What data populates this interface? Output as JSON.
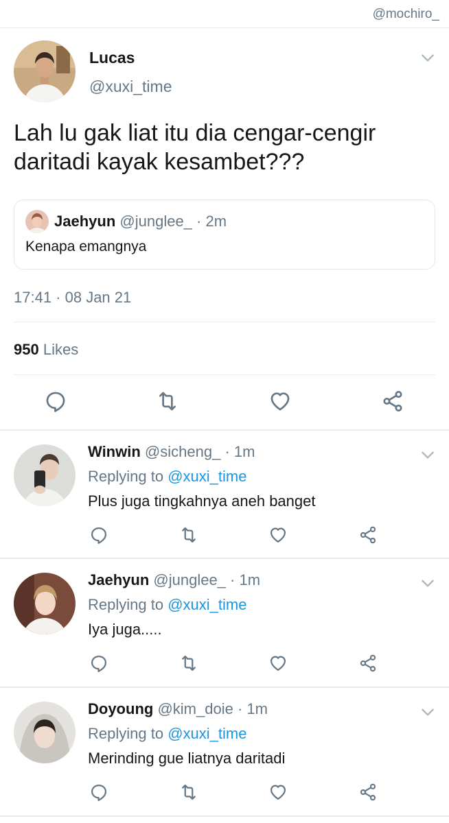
{
  "watermark": "@mochiro_",
  "main_tweet": {
    "name": "Lucas",
    "handle": "@xuxi_time",
    "text": "Lah lu gak liat itu dia cengar-cengir daritadi kayak kesambet???",
    "quote": {
      "name": "Jaehyun",
      "handle": "@junglee_",
      "separator": "·",
      "time": "2m",
      "text": "Kenapa emangnya"
    },
    "timestamp": "17:41 · 08 Jan 21",
    "likes_count": "950",
    "likes_label": "Likes"
  },
  "replies": [
    {
      "name": "Winwin",
      "handle": "@sicheng_",
      "separator": "·",
      "time": "1m",
      "replying_prefix": "Replying to",
      "replying_to": "@xuxi_time",
      "text": "Plus juga tingkahnya aneh banget"
    },
    {
      "name": "Jaehyun",
      "handle": "@junglee_",
      "separator": "·",
      "time": "1m",
      "replying_prefix": "Replying to",
      "replying_to": "@xuxi_time",
      "text": "Iya juga....."
    },
    {
      "name": "Doyoung",
      "handle": "@kim_doie",
      "separator": "·",
      "time": "1m",
      "replying_prefix": "Replying to",
      "replying_to": "@xuxi_time",
      "text": "Merinding gue liatnya daritadi"
    }
  ],
  "icons": {
    "reply": "reply-icon",
    "retweet": "retweet-icon",
    "like": "heart-icon",
    "share": "share-icon",
    "more": "chevron-down-icon"
  },
  "colors": {
    "text": "#14171a",
    "muted": "#657786",
    "link": "#1b95e0",
    "divider": "#e6ecf0"
  }
}
